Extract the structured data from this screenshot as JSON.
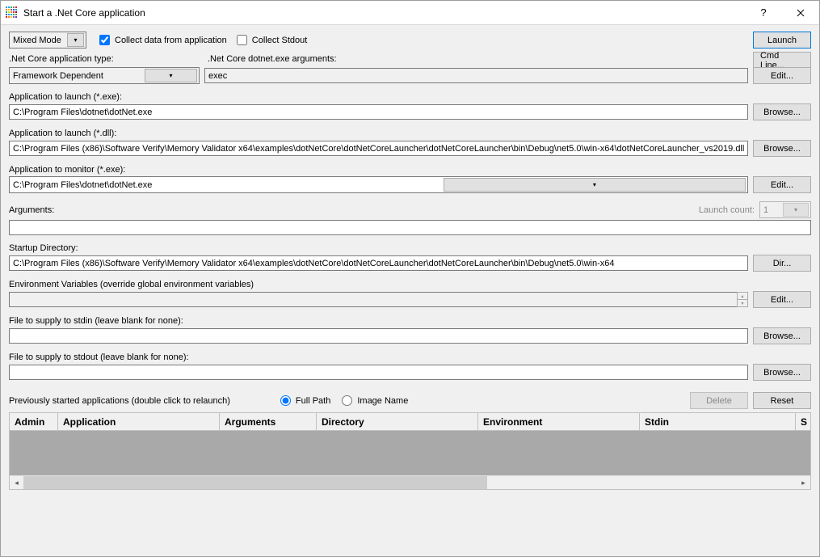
{
  "title": "Start a .Net Core application",
  "top": {
    "mode": "Mixed Mode",
    "collect_data_label": "Collect data from application",
    "collect_data_checked": true,
    "collect_stdout_label": "Collect Stdout",
    "collect_stdout_checked": false
  },
  "buttons": {
    "launch": "Launch",
    "cmdline": "Cmd Line...",
    "edit": "Edit...",
    "browse": "Browse...",
    "dir": "Dir...",
    "delete": "Delete",
    "reset": "Reset"
  },
  "app_type": {
    "label": ".Net Core application type:",
    "value": "Framework Dependent",
    "args_label": ".Net Core dotnet.exe arguments:",
    "args_value": "exec"
  },
  "launch_exe": {
    "label": "Application to launch (*.exe):",
    "value": "C:\\Program Files\\dotnet\\dotNet.exe"
  },
  "launch_dll": {
    "label": "Application to launch (*.dll):",
    "value": "C:\\Program Files (x86)\\Software Verify\\Memory Validator x64\\examples\\dotNetCore\\dotNetCoreLauncher\\dotNetCoreLauncher\\bin\\Debug\\net5.0\\win-x64\\dotNetCoreLauncher_vs2019.dll"
  },
  "monitor_exe": {
    "label": "Application to monitor (*.exe):",
    "value": "C:\\Program Files\\dotnet\\dotNet.exe"
  },
  "arguments": {
    "label": "Arguments:",
    "value": "",
    "launch_count_label": "Launch count:",
    "launch_count_value": "1"
  },
  "startup_dir": {
    "label": "Startup Directory:",
    "value": "C:\\Program Files (x86)\\Software Verify\\Memory Validator x64\\examples\\dotNetCore\\dotNetCoreLauncher\\dotNetCoreLauncher\\bin\\Debug\\net5.0\\win-x64"
  },
  "env_vars": {
    "label": "Environment Variables (override global environment variables)",
    "value": ""
  },
  "stdin": {
    "label": "File to supply to stdin (leave blank for none):",
    "value": ""
  },
  "stdout": {
    "label": "File to supply to stdout (leave blank for none):",
    "value": ""
  },
  "history": {
    "label": "Previously started applications (double click to relaunch)",
    "fullpath_label": "Full Path",
    "imagename_label": "Image Name",
    "selected": "fullpath",
    "columns": {
      "admin": "Admin",
      "application": "Application",
      "arguments": "Arguments",
      "directory": "Directory",
      "environment": "Environment",
      "stdin": "Stdin",
      "s": "S"
    }
  },
  "icon_colors": [
    "#1e90ff",
    "#00a2e8",
    "#22b14c",
    "#7f7f7f",
    "#ed1c24",
    "#ff7f27",
    "#ffc90e",
    "#a349a4",
    "#3f48cc",
    "#00a2e8",
    "#22b14c",
    "#b5e61d",
    "#ff7f27",
    "#ed1c24",
    "#880015",
    "#3f48cc",
    "#1e90ff",
    "#00a2e8",
    "#22b14c",
    "#7f7f7f",
    "#ed1c24",
    "#ff7f27",
    "#ffc90e",
    "#a349a4",
    "#3f48cc"
  ]
}
